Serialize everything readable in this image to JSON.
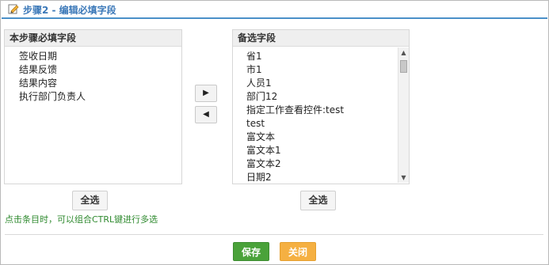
{
  "header": {
    "title": "步骤2 - 编辑必填字段",
    "icon": "edit-icon"
  },
  "left_panel": {
    "title": "本步骤必填字段",
    "items": [
      "签收日期",
      "结果反馈",
      "结果内容",
      "执行部门负责人"
    ]
  },
  "right_panel": {
    "title": "备选字段",
    "items": [
      "省1",
      "市1",
      "人员1",
      "部门12",
      "指定工作查看控件:test",
      "test",
      "富文本",
      "富文本1",
      "富文本2",
      "日期2"
    ]
  },
  "controls": {
    "move_right": "▶",
    "move_left": "◀",
    "select_all": "全选"
  },
  "hint": "点击条目时，可以组合CTRL键进行多选",
  "footer": {
    "save": "保存",
    "close": "关闭"
  },
  "colors": {
    "accent": "#3b78b8",
    "save": "#4aa23a",
    "close": "#f5b042",
    "hint": "#2f8a2f"
  }
}
